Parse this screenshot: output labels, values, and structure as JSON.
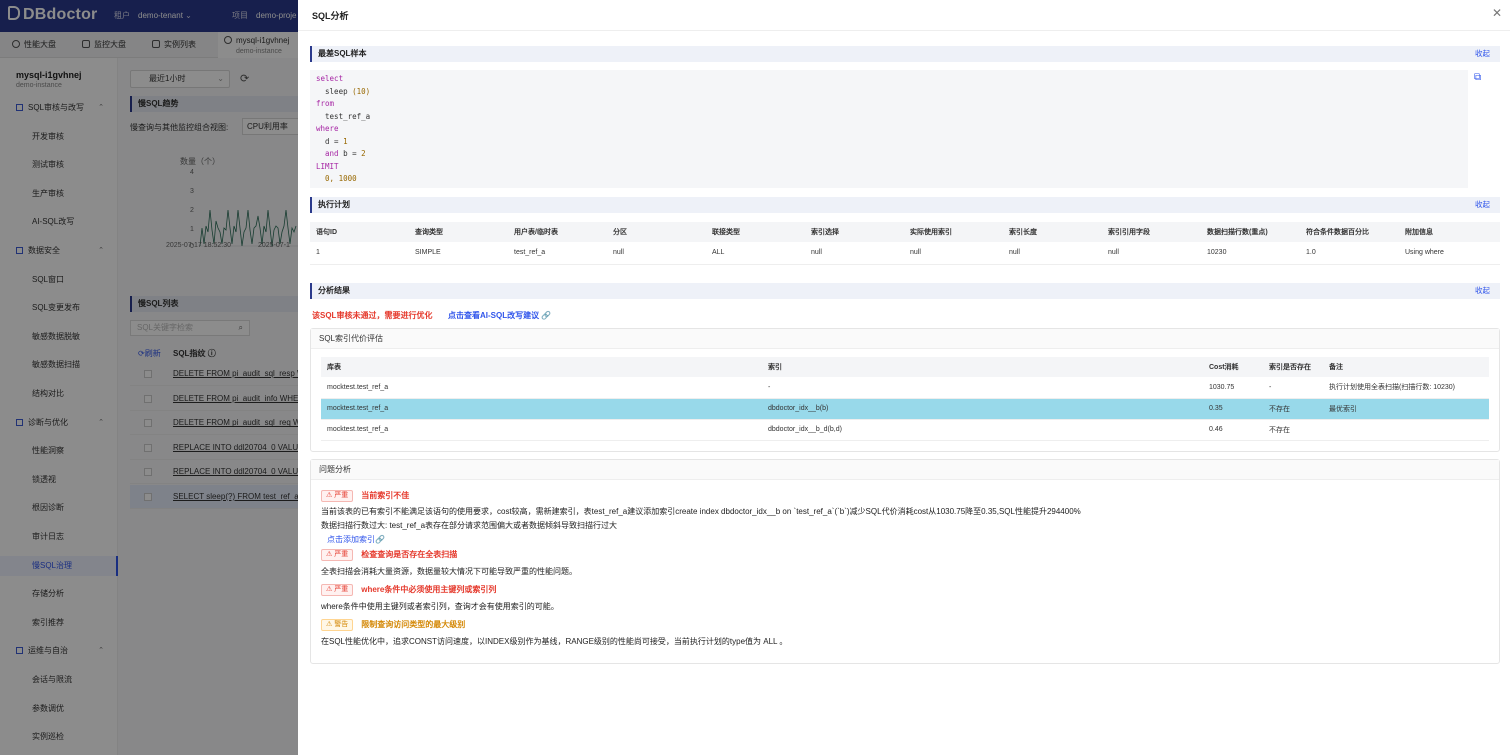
{
  "header": {
    "logo": "DBdoctor",
    "tenant_label": "租户",
    "tenant_value": "demo-tenant",
    "project_label": "项目",
    "project_value": "demo-proje"
  },
  "tabs": [
    {
      "label": "性能大盘"
    },
    {
      "label": "监控大盘"
    },
    {
      "label": "实例列表"
    },
    {
      "label": "mysql-i1gvhnej",
      "sub": "demo-instance"
    }
  ],
  "sidebar": {
    "instance": "mysql-i1gvhnej",
    "instance_sub": "demo-instance",
    "groups": [
      {
        "label": "SQL审核与改写",
        "items": [
          "开发审核",
          "测试审核",
          "生产审核",
          "AI-SQL改写"
        ]
      },
      {
        "label": "数据安全",
        "items": [
          "SQL窗口",
          "SQL变更发布",
          "敏感数据脱敏",
          "敏感数据扫描",
          "结构对比"
        ]
      },
      {
        "label": "诊断与优化",
        "items": [
          "性能洞察",
          "锁透视",
          "根因诊断",
          "审计日志",
          "慢SQL治理",
          "存储分析",
          "索引推荐"
        ]
      },
      {
        "label": "运维与自治",
        "items": [
          "会话与限流",
          "参数调优",
          "实例巡检"
        ]
      }
    ],
    "active_item": "慢SQL治理"
  },
  "content": {
    "time_select": "最近1小时",
    "trend_title": "慢SQL趋势",
    "view_label": "慢查询与其他监控组合视图:",
    "metric_select": "CPU利用率",
    "ylabel": "数量（个）",
    "y_ticks": [
      "4",
      "3",
      "2",
      "1",
      "0"
    ],
    "x_ticks": [
      "2025-07-17 18:52:30",
      "2025-07-1"
    ],
    "list_title": "慢SQL列表",
    "search_placeholder": "SQL关键字检索",
    "col_refresh": "刷新",
    "col_fingerprint": "SQL指纹",
    "sql_rows": [
      "DELETE FROM pi_audit_sql_resp WHE",
      "DELETE FROM pi_audit_info WHERE",
      "DELETE FROM pi_audit_sql_req WHE",
      "REPLACE INTO ddl20704_0 VALUES (",
      "REPLACE INTO ddl20704_0 VALUES (",
      "SELECT sleep(?) FROM test_ref_a WH"
    ]
  },
  "drawer": {
    "title": "SQL分析",
    "collapse_label": "收起",
    "worst_sample": {
      "title": "最差SQL样本",
      "code": [
        [
          {
            "t": "select",
            "c": "kw"
          }
        ],
        [
          {
            "t": "  sleep ",
            "c": ""
          },
          {
            "t": "(10)",
            "c": "num"
          }
        ],
        [
          {
            "t": "from",
            "c": "kw"
          }
        ],
        [
          {
            "t": "  test_ref_a",
            "c": ""
          }
        ],
        [
          {
            "t": "where",
            "c": "kw"
          }
        ],
        [
          {
            "t": "  d = ",
            "c": ""
          },
          {
            "t": "1",
            "c": "num"
          }
        ],
        [
          {
            "t": "  and",
            "c": "kw"
          },
          {
            "t": " b = ",
            "c": ""
          },
          {
            "t": "2",
            "c": "num"
          }
        ],
        [
          {
            "t": "LIMIT",
            "c": "kw"
          }
        ],
        [
          {
            "t": "  0, 1000",
            "c": "num"
          }
        ]
      ]
    },
    "plan": {
      "title": "执行计划",
      "columns": [
        "语句ID",
        "查询类型",
        "用户表/临时表",
        "分区",
        "联接类型",
        "索引选择",
        "实际使用索引",
        "索引长度",
        "索引引用字段",
        "数据扫描行数(重点)",
        "符合条件数据百分比",
        "附加信息"
      ],
      "rows": [
        [
          "1",
          "SIMPLE",
          "test_ref_a",
          "null",
          "ALL",
          "null",
          "null",
          "null",
          "null",
          "10230",
          "1.0",
          "Using where"
        ]
      ]
    },
    "analysis": {
      "title": "分析结果",
      "fail_msg": "该SQL审核未通过，需要进行优化",
      "ai_link": "点击查看AI-SQL改写建议 🔗",
      "cost_card": {
        "title": "SQL索引代价评估",
        "columns": [
          "库表",
          "索引",
          "Cost消耗",
          "索引是否存在",
          "备注"
        ],
        "rows": [
          [
            "mocktest.test_ref_a",
            "-",
            "1030.75",
            "-",
            "执行计划使用全表扫描(扫描行数: 10230)"
          ],
          [
            "mocktest.test_ref_a",
            "dbdoctor_idx__b(b)",
            "0.35",
            "不存在",
            "最优索引"
          ],
          [
            "mocktest.test_ref_a",
            "dbdoctor_idx__b_d(b,d)",
            "0.46",
            "不存在",
            ""
          ]
        ],
        "highlight_row": 1
      },
      "issues_card": {
        "title": "问题分析",
        "issues": [
          {
            "tag": "⚠ 严重",
            "level": "severe",
            "title": "当前索引不佳",
            "lines": [
              "当前该表的已有索引不能满足该语句的使用要求，cost较高，需新建索引，表test_ref_a建议添加索引create index dbdoctor_idx__b on `test_ref_a`(`b`)减少SQL代价消耗cost从1030.75降至0.35,SQL性能提升294400%",
              "数据扫描行数过大: test_ref_a表存在部分请求范围偏大或者数据倾斜导致扫描行过大"
            ],
            "link": "点击添加索引🔗"
          },
          {
            "tag": "⚠ 严重",
            "level": "severe",
            "title": "检查查询是否存在全表扫描",
            "lines": [
              "全表扫描会消耗大量资源，数据量较大情况下可能导致严重的性能问题。"
            ]
          },
          {
            "tag": "⚠ 严重",
            "level": "severe",
            "title": "where条件中必须使用主键列或索引列",
            "lines": [
              "where条件中使用主键列或者索引列，查询才会有使用索引的可能。"
            ]
          },
          {
            "tag": "⚠ 警告",
            "level": "warn",
            "title": "限制查询访问类型的最大级别",
            "lines": [
              "在SQL性能优化中，追求CONST访问速度，以INDEX级别作为基线，RANGE级别的性能尚可接受，当前执行计划的type值为 ALL 。"
            ]
          }
        ]
      }
    }
  }
}
